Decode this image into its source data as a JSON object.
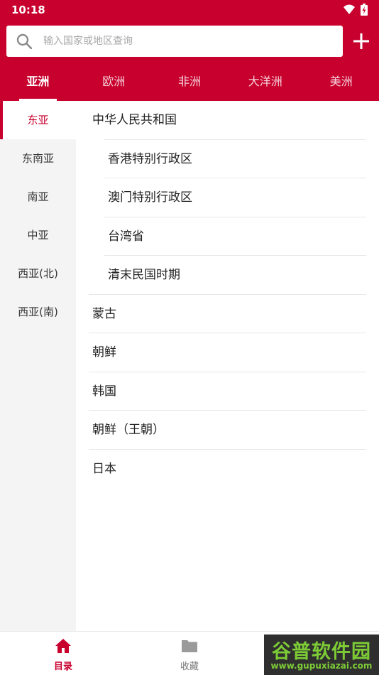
{
  "status_bar": {
    "time": "10:18"
  },
  "search": {
    "placeholder": "输入国家或地区查询"
  },
  "tabs": [
    {
      "label": "亚洲",
      "active": true
    },
    {
      "label": "欧洲",
      "active": false
    },
    {
      "label": "非洲",
      "active": false
    },
    {
      "label": "大洋洲",
      "active": false
    },
    {
      "label": "美洲",
      "active": false
    }
  ],
  "sidebar": {
    "items": [
      {
        "label": "东亚",
        "active": true
      },
      {
        "label": "东南亚",
        "active": false
      },
      {
        "label": "南亚",
        "active": false
      },
      {
        "label": "中亚",
        "active": false
      },
      {
        "label": "西亚(北)",
        "active": false
      },
      {
        "label": "西亚(南)",
        "active": false
      }
    ]
  },
  "list": {
    "items": [
      {
        "label": "中华人民共和国",
        "indent": false
      },
      {
        "label": "香港特别行政区",
        "indent": true
      },
      {
        "label": "澳门特别行政区",
        "indent": true
      },
      {
        "label": "台湾省",
        "indent": true
      },
      {
        "label": "清末民国时期",
        "indent": true
      },
      {
        "label": "蒙古",
        "indent": false
      },
      {
        "label": "朝鲜",
        "indent": false
      },
      {
        "label": "韩国",
        "indent": false
      },
      {
        "label": "朝鲜（王朝）",
        "indent": false
      },
      {
        "label": "日本",
        "indent": false
      }
    ]
  },
  "bottom_nav": {
    "items": [
      {
        "label": "目录",
        "icon": "home-icon",
        "active": true
      },
      {
        "label": "收藏",
        "icon": "folder-icon",
        "active": false
      }
    ]
  },
  "watermark": {
    "text": "谷普软件园",
    "url": "www.gupuxiazai.com"
  },
  "colors": {
    "brand": "#c8002e",
    "sidebar_bg": "#f4f4f4",
    "watermark_green": "#7dcc36"
  }
}
